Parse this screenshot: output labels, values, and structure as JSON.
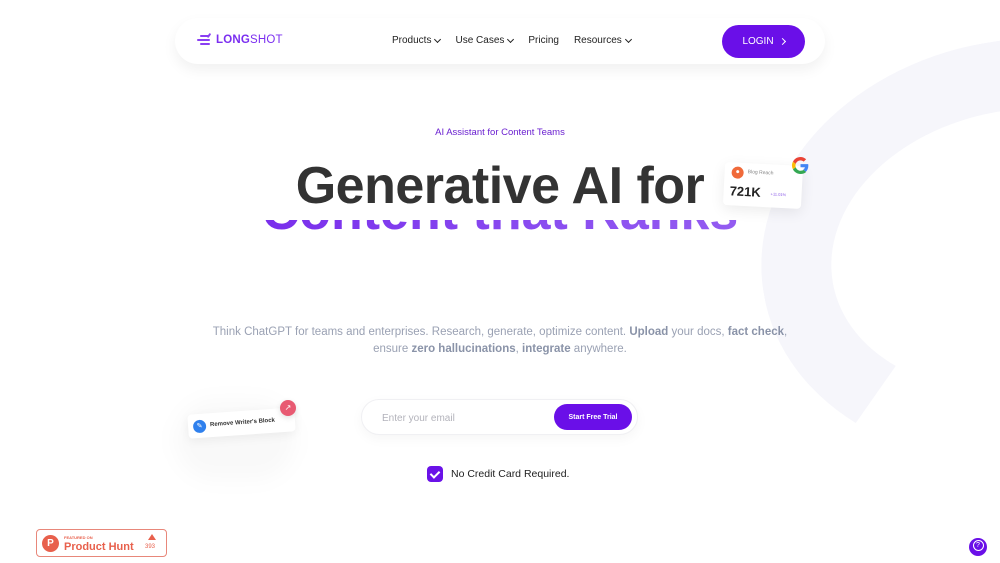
{
  "brand": {
    "name_bold": "LONG",
    "name_light": "SHOT",
    "accent_color": "#6a0fe8"
  },
  "nav": {
    "items": [
      {
        "label": "Products",
        "has_dropdown": true
      },
      {
        "label": "Use Cases",
        "has_dropdown": true
      },
      {
        "label": "Pricing",
        "has_dropdown": false
      },
      {
        "label": "Resources",
        "has_dropdown": true
      }
    ],
    "login_label": "LOGIN",
    "login_icon": "chevron-right-icon"
  },
  "hero": {
    "eyebrow": "AI Assistant for Content Teams",
    "headline_line1": "Generative AI for",
    "headline_line2": "Content that Ranks",
    "subtext": {
      "part1": "Think ChatGPT for teams and enterprises. Research, generate, optimize content. ",
      "bold1": "Upload",
      "part2": " your docs, ",
      "bold2": "fact check",
      "part3": ", ensure ",
      "bold3": "zero hallucinations",
      "part4": ", ",
      "bold4": "integrate",
      "part5": " anywhere."
    }
  },
  "blog_card": {
    "label": "Blog Reach",
    "value": "721K",
    "delta": "+11.01%",
    "icon": "user-icon",
    "badge_icon": "google-icon"
  },
  "writer_card": {
    "label": "Remove Writer's Block",
    "icon": "pen-icon",
    "badge_icon": "trend-up-icon"
  },
  "signup": {
    "email_placeholder": "Enter your email",
    "email_value": "",
    "cta_label": "Start Free Trial",
    "no_cc_label": "No Credit Card Required.",
    "no_cc_checked": true
  },
  "product_hunt": {
    "small_label": "FEATURED ON",
    "name": "Product Hunt",
    "logo_letter": "P",
    "upvotes": "393"
  },
  "help": {
    "icon": "help-icon",
    "glyph": "?"
  }
}
